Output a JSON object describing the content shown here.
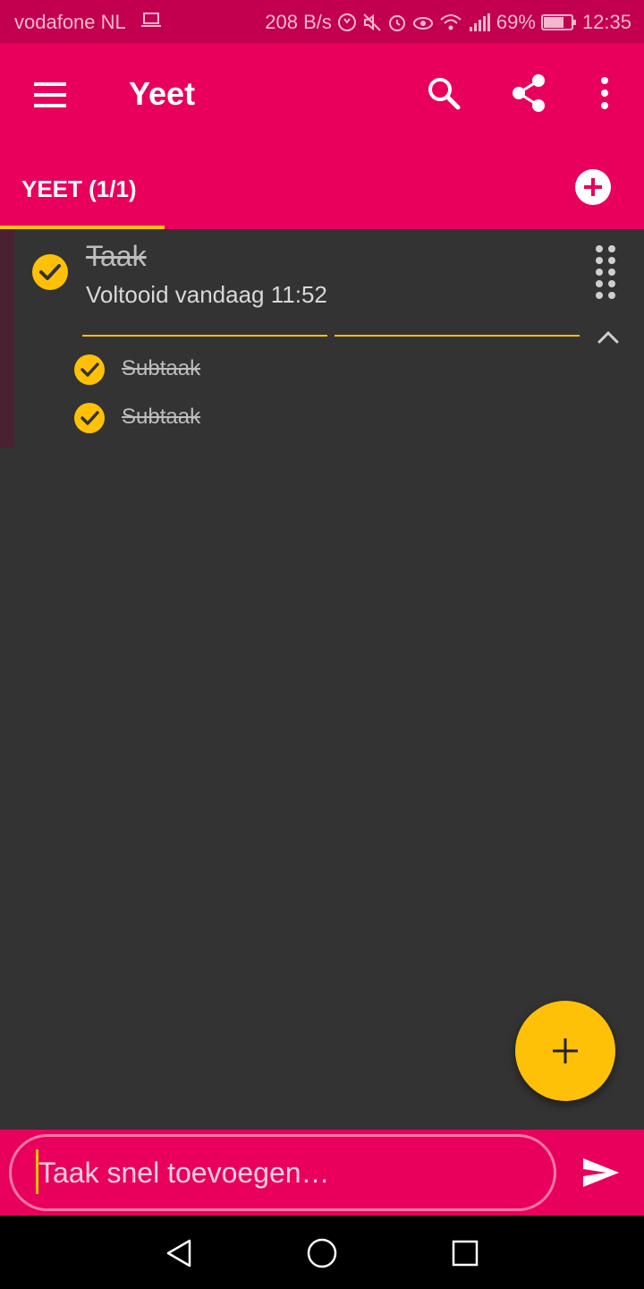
{
  "colors": {
    "primary": "#e8005c",
    "status_bar": "#c2004f",
    "accent": "#ffc107",
    "background": "#333333"
  },
  "status_bar": {
    "carrier": "vodafone NL",
    "net_speed": "208 B/s",
    "battery": "69%",
    "time": "12:35",
    "icons": [
      "laptop-icon",
      "data-saver-icon",
      "mute-icon",
      "alarm-icon",
      "eye-comfort-icon",
      "wifi-icon",
      "signal-icon",
      "battery-icon"
    ]
  },
  "app_bar": {
    "title": "Yeet",
    "icons": [
      "menu-icon",
      "search-icon",
      "share-icon",
      "more-vert-icon"
    ]
  },
  "tabs": [
    {
      "label": "YEET (1/1)",
      "selected": true
    }
  ],
  "task": {
    "title": "Taak",
    "subtitle": "Voltooid vandaag 11:52",
    "completed": true,
    "progress": 1.0,
    "subtasks": [
      {
        "label": "Subtaak",
        "completed": true
      },
      {
        "label": "Subtaak",
        "completed": true
      }
    ]
  },
  "quick_add": {
    "placeholder": "Taak snel toevoegen…"
  },
  "nav_bar": {
    "icons": [
      "back-icon",
      "home-icon",
      "recents-icon"
    ]
  }
}
